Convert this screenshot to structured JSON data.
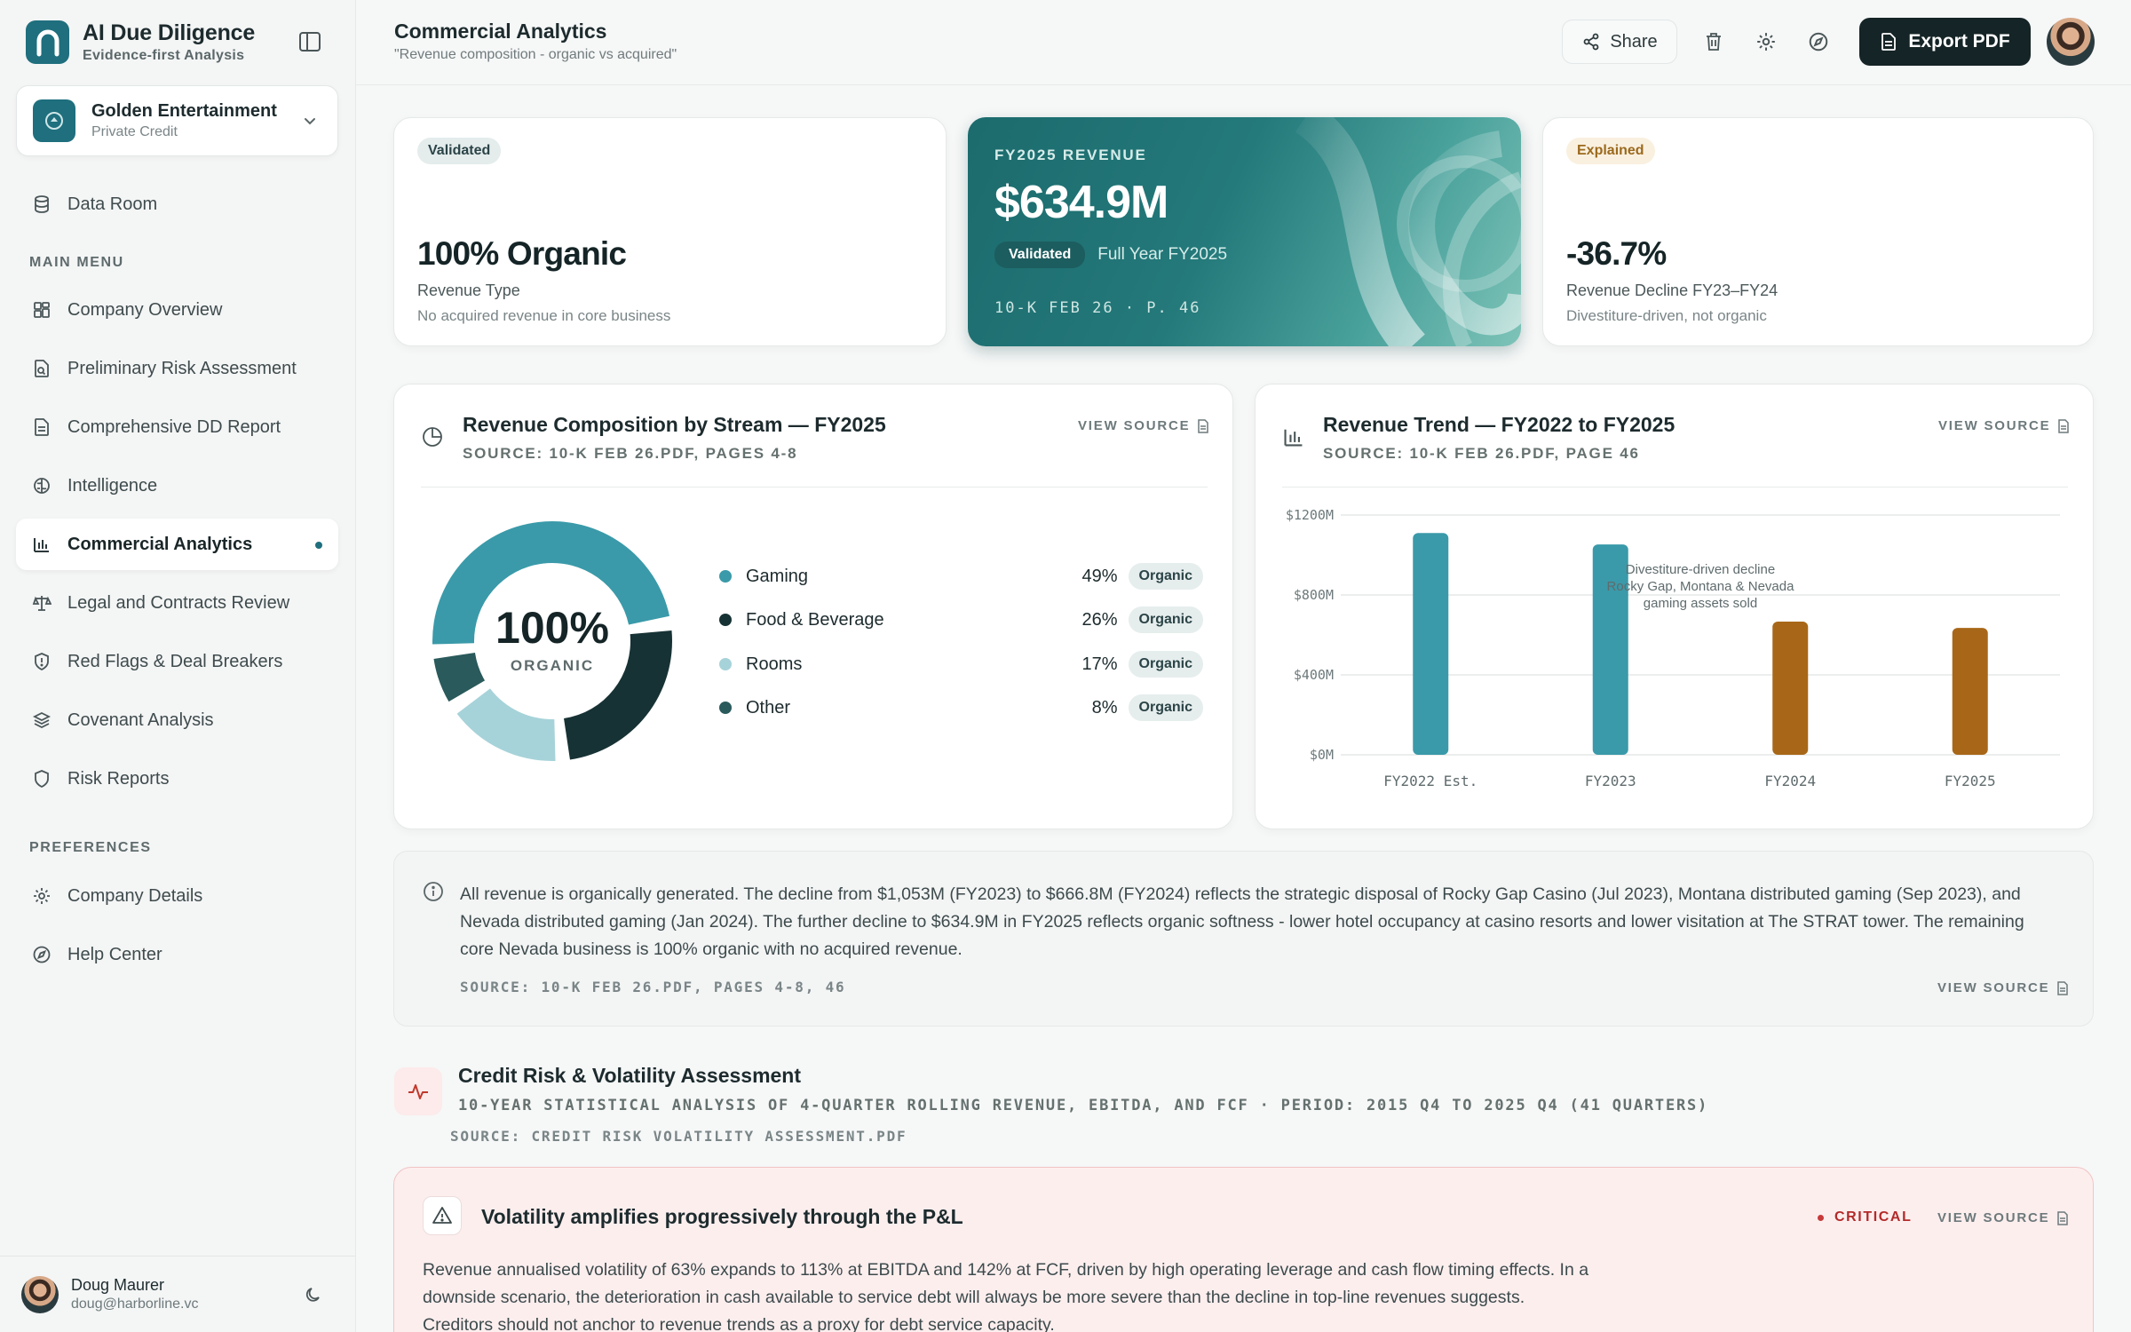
{
  "brand": {
    "title": "AI Due Diligence",
    "subtitle": "Evidence-first Analysis"
  },
  "company": {
    "name": "Golden Entertainment",
    "type": "Private Credit"
  },
  "nav": {
    "data_room": "Data Room",
    "main_menu_label": "MAIN MENU",
    "items": [
      {
        "label": "Company Overview",
        "icon": "grid-icon"
      },
      {
        "label": "Preliminary Risk Assessment",
        "icon": "doc-search-icon"
      },
      {
        "label": "Comprehensive DD Report",
        "icon": "document-icon"
      },
      {
        "label": "Intelligence",
        "icon": "brain-icon"
      },
      {
        "label": "Commercial Analytics",
        "icon": "bar-chart-icon",
        "active": true
      },
      {
        "label": "Legal and Contracts Review",
        "icon": "scale-icon"
      },
      {
        "label": "Red Flags & Deal Breakers",
        "icon": "shield-alert-icon"
      },
      {
        "label": "Covenant Analysis",
        "icon": "layers-icon"
      },
      {
        "label": "Risk Reports",
        "icon": "shield-icon"
      }
    ],
    "preferences_label": "PREFERENCES",
    "prefs": [
      {
        "label": "Company Details",
        "icon": "gear-icon"
      },
      {
        "label": "Help Center",
        "icon": "compass-icon"
      }
    ]
  },
  "user": {
    "name": "Doug Maurer",
    "email": "doug@harborline.vc"
  },
  "header": {
    "title": "Commercial Analytics",
    "subtitle": "\"Revenue composition - organic vs acquired\"",
    "share_label": "Share",
    "export_label": "Export PDF"
  },
  "kpis": {
    "organic": {
      "badge": "Validated",
      "value": "100% Organic",
      "label": "Revenue Type",
      "note": "No acquired revenue in core business"
    },
    "revenue": {
      "label": "FY2025 REVENUE",
      "value": "$634.9M",
      "badge": "Validated",
      "period": "Full Year FY2025",
      "source": "10-K FEB 26 · P. 46"
    },
    "decline": {
      "badge": "Explained",
      "value": "-36.7%",
      "label": "Revenue Decline FY23–FY24",
      "note": "Divestiture-driven, not organic"
    }
  },
  "composition": {
    "title": "Revenue Composition by Stream — FY2025",
    "source": "SOURCE: 10-K FEB 26.PDF, PAGES 4-8",
    "view_source": "VIEW SOURCE",
    "center_value": "100%",
    "center_label": "ORGANIC"
  },
  "trend": {
    "title": "Revenue Trend — FY2022 to FY2025",
    "source": "SOURCE: 10-K FEB 26.PDF, PAGE 46",
    "view_source": "VIEW SOURCE",
    "annotation": [
      "Divestiture-driven decline",
      "Rocky Gap, Montana & Nevada",
      "gaming assets sold"
    ]
  },
  "chart_data": [
    {
      "type": "pie",
      "title": "Revenue Composition by Stream — FY2025",
      "series": [
        {
          "name": "Gaming",
          "value": 49,
          "tag": "Organic",
          "color": "#3a9aa9"
        },
        {
          "name": "Food & Beverage",
          "value": 26,
          "tag": "Organic",
          "color": "#173234"
        },
        {
          "name": "Rooms",
          "value": 17,
          "tag": "Organic",
          "color": "#a6d3d9"
        },
        {
          "name": "Other",
          "value": 8,
          "tag": "Organic",
          "color": "#2a5a5b"
        }
      ]
    },
    {
      "type": "bar",
      "title": "Revenue Trend — FY2022 to FY2025",
      "categories": [
        "FY2022 Est.",
        "FY2023",
        "FY2024",
        "FY2025"
      ],
      "values": [
        1110,
        1053,
        666.8,
        634.9
      ],
      "colors": [
        "#3a9aa9",
        "#3a9aa9",
        "#a86718",
        "#a86718"
      ],
      "yticks": [
        "$0M",
        "$400M",
        "$800M",
        "$1200M"
      ],
      "ylim": [
        0,
        1200
      ],
      "ylabel": "",
      "grid": true
    }
  ],
  "note": {
    "text": "All revenue is organically generated. The decline from $1,053M (FY2023) to $666.8M (FY2024) reflects the strategic disposal of Rocky Gap Casino (Jul 2023), Montana distributed gaming (Sep 2023), and Nevada distributed gaming (Jan 2024). The further decline to $634.9M in FY2025 reflects organic softness - lower hotel occupancy at casino resorts and lower visitation at The STRAT tower. The remaining core Nevada business is 100% organic with no acquired revenue.",
    "source": "SOURCE: 10-K FEB 26.PDF, PAGES 4-8, 46",
    "view_source": "VIEW SOURCE"
  },
  "credit": {
    "title": "Credit Risk & Volatility Assessment",
    "subtitle": "10-YEAR STATISTICAL ANALYSIS OF 4-QUARTER ROLLING REVENUE, EBITDA, AND FCF · PERIOD: 2015 Q4 TO 2025 Q4 (41 QUARTERS)",
    "source": "SOURCE: CREDIT RISK VOLATILITY ASSESSMENT.PDF"
  },
  "alert": {
    "title": "Volatility amplifies progressively through the P&L",
    "severity": "CRITICAL",
    "view_source": "VIEW SOURCE",
    "text": "Revenue annualised volatility of 63% expands to 113% at EBITDA and 142% at FCF, driven by high operating leverage and cash flow timing effects. In a downside scenario, the deterioration in cash available to service debt will always be more severe than the decline in top-line revenues suggests. Creditors should not anchor to revenue trends as a proxy for debt service capacity."
  }
}
